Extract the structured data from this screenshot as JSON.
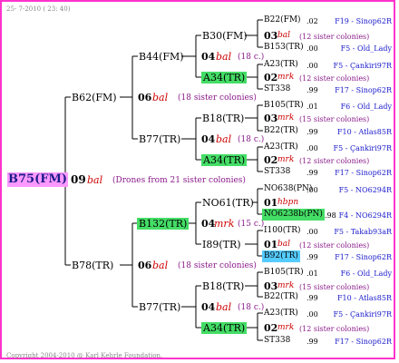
{
  "header": {
    "date": "25-  7-2010 ( 23: 40)"
  },
  "footer": {
    "copyright": "Copyright 2004-2010 @ Karl Kehrle Foundation."
  },
  "root": {
    "id": "B75(FM)",
    "gen": "09",
    "race": "bal",
    "note": "(Drones from 21 sister colonies)"
  },
  "gen1": [
    {
      "id": "B62(FM)",
      "gen": "06",
      "race": "bal",
      "note": "(18 sister colonies)"
    },
    {
      "id": "B78(TR)",
      "gen": "06",
      "race": "bal",
      "note": "(18 sister colonies)"
    }
  ],
  "gen2": [
    {
      "id": "B44(FM)",
      "gen": "04",
      "race": "bal",
      "note": "(18 c.)"
    },
    {
      "id": "B77(TR)",
      "gen": "04",
      "race": "bal",
      "note": "(18 c.)"
    },
    {
      "id": "B132(TR)",
      "gen": "04",
      "race": "mrk",
      "note": "(15 c.)"
    },
    {
      "id": "B77(TR)",
      "gen": "04",
      "race": "bal",
      "note": "(18 c.)"
    }
  ],
  "gen3": [
    {
      "id": "B30(FM)",
      "gen": "03",
      "race": "bal",
      "note": "(12 sister colonies)"
    },
    {
      "id": "A34(TR)",
      "gen": "02",
      "race": "mrk",
      "note": "(12 sister colonies)"
    },
    {
      "id": "B18(TR)",
      "gen": "03",
      "race": "mrk",
      "note": "(15 sister colonies)"
    },
    {
      "id": "A34(TR)",
      "gen": "02",
      "race": "mrk",
      "note": "(12 sister colonies)"
    },
    {
      "id": "NO61(TR)",
      "gen": "01",
      "race": "hbpn",
      "note": ""
    },
    {
      "id": "I89(TR)",
      "gen": "01",
      "race": "bal",
      "note": "(12 sister colonies)"
    },
    {
      "id": "B18(TR)",
      "gen": "03",
      "race": "mrk",
      "note": "(15 sister colonies)"
    },
    {
      "id": "A34(TR)",
      "gen": "02",
      "race": "mrk",
      "note": "(12 sister colonies)"
    }
  ],
  "gen4": [
    {
      "id": "B22(FM)",
      "val": ".02",
      "src": "F19 - Sinop62R"
    },
    {
      "id": "B153(TR)",
      "val": ".00",
      "src": "F5 - Old_Lady"
    },
    {
      "id": "A23(TR)",
      "val": ".00",
      "src": "F5 - Çankiri97R"
    },
    {
      "id": "ST338",
      "val": ".99",
      "src": "F17 - Sinop62R"
    },
    {
      "id": "B105(TR)",
      "val": ".01",
      "src": "F6 - Old_Lady"
    },
    {
      "id": "B22(TR)",
      "val": ".99",
      "src": "F10 - Atlas85R"
    },
    {
      "id": "A23(TR)",
      "val": ".00",
      "src": "F5 - Çankiri97R"
    },
    {
      "id": "ST338",
      "val": ".99",
      "src": "F17 - Sinop62R"
    },
    {
      "id": "NO638(PN)",
      "val": ".00",
      "src": "F5 - NO6294R"
    },
    {
      "id": "NO6238b(PN)",
      "val": ".98",
      "src": "F4 - NO6294R"
    },
    {
      "id": "I100(TR)",
      "val": ".00",
      "src": "F5 - Takab93aR"
    },
    {
      "id": "B92(TR)",
      "val": ".99",
      "src": "F17 - Sinop62R"
    },
    {
      "id": "B105(TR)",
      "val": ".01",
      "src": "F6 - Old_Lady"
    },
    {
      "id": "B22(TR)",
      "val": ".99",
      "src": "F10 - Atlas85R"
    },
    {
      "id": "A23(TR)",
      "val": ".00",
      "src": "F5 - Çankiri97R"
    },
    {
      "id": "ST338",
      "val": ".99",
      "src": "F17 - Sinop62R"
    }
  ],
  "colors": {
    "frame": "#ff33cc",
    "root_bg": "#ff99ff",
    "green": "#44dd66",
    "cyan": "#55ccff",
    "race": "#cc0000",
    "note": "#8a1a8a",
    "source": "#1a1acc"
  }
}
